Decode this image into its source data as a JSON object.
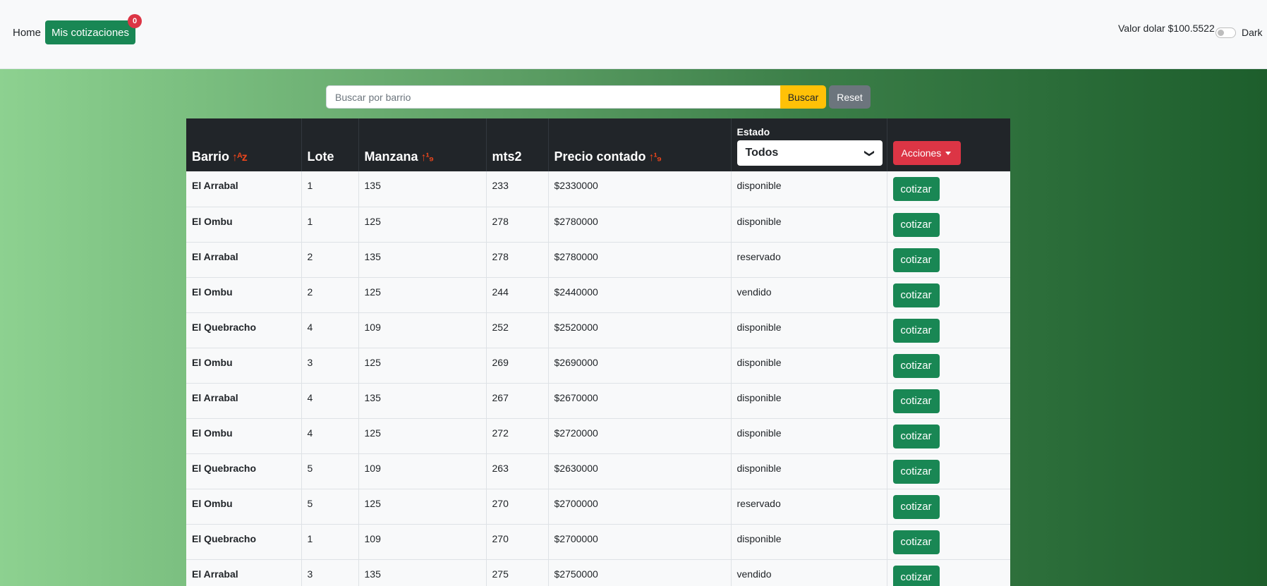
{
  "nav": {
    "home": "Home",
    "cotizaciones": "Mis cotizaciones",
    "badge_count": "0",
    "dolar": "Valor dolar $100.5522",
    "dark_label": "Dark"
  },
  "search": {
    "placeholder": "Buscar por barrio",
    "buscar": "Buscar",
    "reset": "Reset"
  },
  "table": {
    "headers": {
      "barrio": "Barrio",
      "lote": "Lote",
      "manzana": "Manzana",
      "mts2": "mts2",
      "precio": "Precio contado",
      "estado": "Estado",
      "estado_selected": "Todos",
      "acciones": "Acciones"
    },
    "sort_icons": {
      "alpha": "↑ᴬᴢ",
      "num": "↑¹₉"
    },
    "action_label": "cotizar",
    "rows": [
      {
        "barrio": "El Arrabal",
        "lote": "1",
        "manzana": "135",
        "mts2": "233",
        "precio": "$2330000",
        "estado": "disponible"
      },
      {
        "barrio": "El Ombu",
        "lote": "1",
        "manzana": "125",
        "mts2": "278",
        "precio": "$2780000",
        "estado": "disponible"
      },
      {
        "barrio": "El Arrabal",
        "lote": "2",
        "manzana": "135",
        "mts2": "278",
        "precio": "$2780000",
        "estado": "reservado"
      },
      {
        "barrio": "El Ombu",
        "lote": "2",
        "manzana": "125",
        "mts2": "244",
        "precio": "$2440000",
        "estado": "vendido"
      },
      {
        "barrio": "El Quebracho",
        "lote": "4",
        "manzana": "109",
        "mts2": "252",
        "precio": "$2520000",
        "estado": "disponible"
      },
      {
        "barrio": "El Ombu",
        "lote": "3",
        "manzana": "125",
        "mts2": "269",
        "precio": "$2690000",
        "estado": "disponible"
      },
      {
        "barrio": "El Arrabal",
        "lote": "4",
        "manzana": "135",
        "mts2": "267",
        "precio": "$2670000",
        "estado": "disponible"
      },
      {
        "barrio": "El Ombu",
        "lote": "4",
        "manzana": "125",
        "mts2": "272",
        "precio": "$2720000",
        "estado": "disponible"
      },
      {
        "barrio": "El Quebracho",
        "lote": "5",
        "manzana": "109",
        "mts2": "263",
        "precio": "$2630000",
        "estado": "disponible"
      },
      {
        "barrio": "El Ombu",
        "lote": "5",
        "manzana": "125",
        "mts2": "270",
        "precio": "$2700000",
        "estado": "reservado"
      },
      {
        "barrio": "El Quebracho",
        "lote": "1",
        "manzana": "109",
        "mts2": "270",
        "precio": "$2700000",
        "estado": "disponible"
      },
      {
        "barrio": "El Arrabal",
        "lote": "3",
        "manzana": "135",
        "mts2": "275",
        "precio": "$2750000",
        "estado": "vendido"
      }
    ]
  }
}
